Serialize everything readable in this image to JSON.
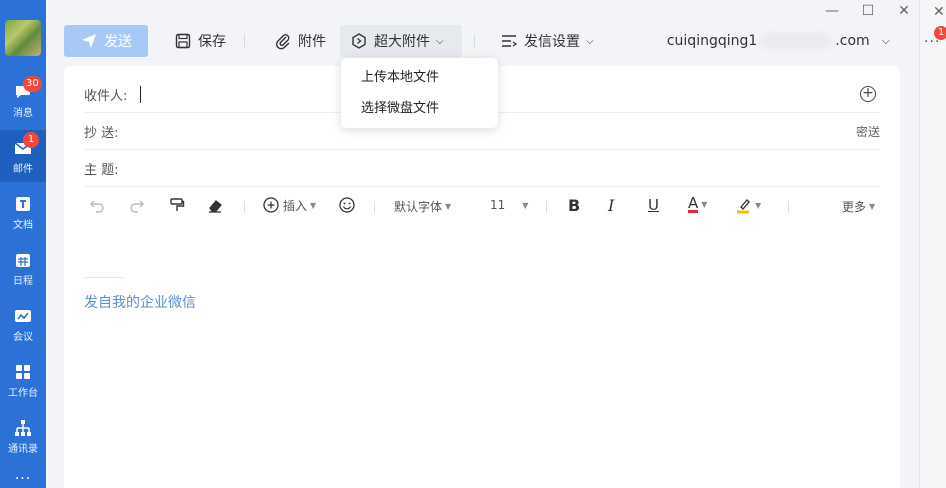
{
  "sidebar": {
    "items": [
      {
        "label": "消息",
        "badge": "30"
      },
      {
        "label": "邮件",
        "badge": "1"
      },
      {
        "label": "文档"
      },
      {
        "label": "日程"
      },
      {
        "label": "会议"
      },
      {
        "label": "工作台"
      },
      {
        "label": "通讯录"
      }
    ],
    "more": "···"
  },
  "window": {
    "minimize": "—",
    "maximize": "☐",
    "close": "✕"
  },
  "toolbar": {
    "send": "发送",
    "save": "保存",
    "attach": "附件",
    "big_attach": "超大附件",
    "send_settings": "发信设置",
    "account_prefix": "cuiqingqing1",
    "account_suffix": ".com"
  },
  "big_attach_menu": [
    "上传本地文件",
    "选择微盘文件"
  ],
  "fields": {
    "to_label": "收件人:",
    "cc_label": "抄  送:",
    "bcc_link": "密送",
    "subject_label": "主  题:"
  },
  "format_bar": {
    "insert": "插入",
    "font": "默认字体",
    "size": "11",
    "more": "更多"
  },
  "signature": "发自我的企业微信",
  "right_edge": {
    "badge": "1",
    "dots": "···",
    "close": "✕"
  },
  "colors": {
    "sidebar": "#2b71d6",
    "send_button": "#a8c9f5",
    "signature": "#5b8fd4",
    "badge": "#f0483e"
  }
}
